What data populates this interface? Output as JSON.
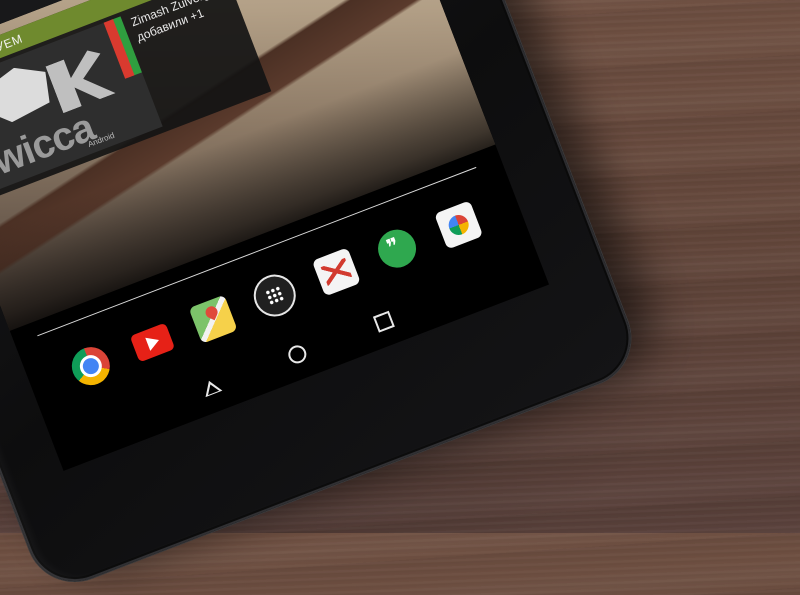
{
  "widget": {
    "header": "РЕКОМЕНДУЕМ",
    "logo_text": "twicca",
    "logo_subtext": "Android",
    "user_name": "Zimash Zulvergo",
    "action_text": "добавили +1"
  },
  "dock": {
    "apps": [
      {
        "icon": "chrome-icon"
      },
      {
        "icon": "youtube-icon"
      },
      {
        "icon": "maps-icon"
      },
      {
        "icon": "app-launcher-icon"
      },
      {
        "icon": "gmail-icon"
      },
      {
        "icon": "hangouts-icon"
      },
      {
        "icon": "photos-icon"
      }
    ]
  },
  "navigation": {
    "buttons": [
      "back-icon",
      "home-icon",
      "recent-apps-icon"
    ]
  },
  "colors": {
    "table_wood": "#62463a",
    "bezel": "#141416",
    "widget_header": "#6f8a2e"
  }
}
